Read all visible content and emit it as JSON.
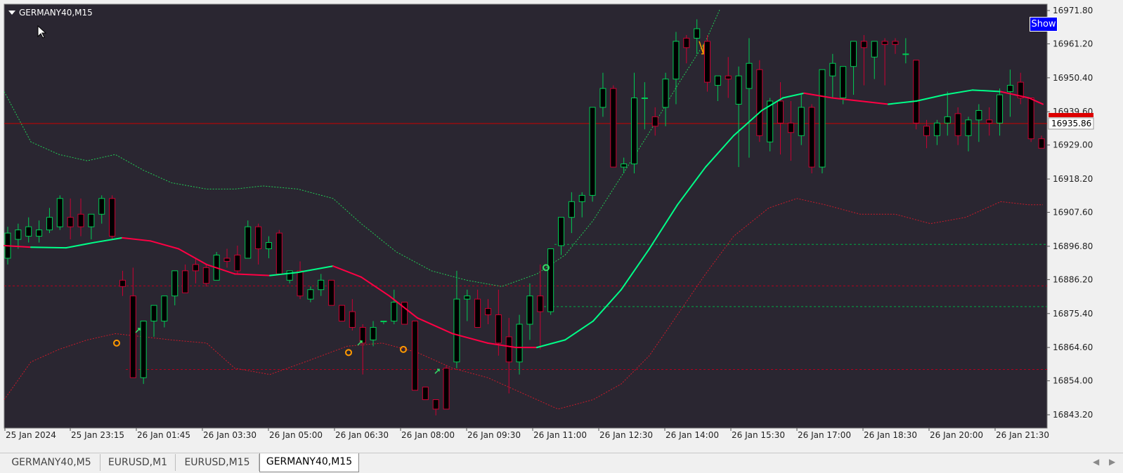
{
  "window": {
    "symbol_title": "GERMANY40,M15",
    "show_button": "Show"
  },
  "chart_data": {
    "type": "candlestick",
    "symbol": "GERMANY40",
    "timeframe": "M15",
    "current_price": 16935.86,
    "price_label": "16935.86",
    "y_ticks": [
      16971.8,
      16961.2,
      16950.4,
      16939.6,
      16929.0,
      16918.2,
      16907.6,
      16896.8,
      16886.2,
      16875.4,
      16864.6,
      16854.0,
      16843.2
    ],
    "y_tick_labels": [
      "16971.80",
      "16961.20",
      "16950.40",
      "16939.60",
      "16929.00",
      "16918.20",
      "16907.60",
      "16896.80",
      "16886.20",
      "16875.40",
      "16864.60",
      "16854.00",
      "16843.20"
    ],
    "x_tick_labels": [
      "25 Jan 2024",
      "25 Jan 23:15",
      "26 Jan 01:45",
      "26 Jan 03:30",
      "26 Jan 05:00",
      "26 Jan 06:30",
      "26 Jan 08:00",
      "26 Jan 09:30",
      "26 Jan 11:00",
      "26 Jan 12:30",
      "26 Jan 14:00",
      "26 Jan 15:30",
      "26 Jan 17:00",
      "26 Jan 18:30",
      "26 Jan 20:00",
      "26 Jan 21:30"
    ],
    "candles": [
      [
        16893,
        16903,
        16891,
        16901
      ],
      [
        16899,
        16904,
        16896,
        16902
      ],
      [
        16900,
        16906,
        16898,
        16903
      ],
      [
        16900,
        16905,
        16898,
        16902
      ],
      [
        16902,
        16909,
        16901,
        16906
      ],
      [
        16903,
        16913,
        16902,
        16912
      ],
      [
        16906,
        16912,
        16899,
        16903
      ],
      [
        16907,
        16912,
        16900,
        16903
      ],
      [
        16903,
        16907,
        16899,
        16907
      ],
      [
        16907,
        16913,
        16904,
        16912
      ],
      [
        16912,
        16913,
        16899,
        16900
      ],
      [
        16886,
        16889,
        16881,
        16884
      ],
      [
        16881,
        16890,
        16855,
        16855
      ],
      [
        16855,
        16869,
        16853,
        16873
      ],
      [
        16873,
        16877,
        16868,
        16878
      ],
      [
        16873,
        16878,
        16871,
        16881
      ],
      [
        16881,
        16889,
        16878,
        16889
      ],
      [
        16889,
        16891,
        16883,
        16882
      ],
      [
        16891,
        16893,
        16885,
        16889
      ],
      [
        16890,
        16891,
        16884,
        16885
      ],
      [
        16886,
        16895,
        16886,
        16894
      ],
      [
        16893,
        16896,
        16890,
        16892
      ],
      [
        16894,
        16897,
        16888,
        16889
      ],
      [
        16893,
        16905,
        16893,
        16903
      ],
      [
        16903,
        16904,
        16891,
        16896
      ],
      [
        16896,
        16900,
        16893,
        16898
      ],
      [
        16901,
        16902,
        16888,
        16888
      ],
      [
        16886,
        16888,
        16885,
        16889
      ],
      [
        16889,
        16892,
        16880,
        16881
      ],
      [
        16880,
        16884,
        16879,
        16883
      ],
      [
        16883,
        16888,
        16881,
        16886
      ],
      [
        16886,
        16886,
        16878,
        16878
      ],
      [
        16878,
        16877,
        16874,
        16873
      ],
      [
        16876,
        16880,
        16870,
        16871
      ],
      [
        16871,
        16872,
        16856,
        16866
      ],
      [
        16867,
        16873,
        16865,
        16871
      ],
      [
        16873,
        16873,
        16872,
        16873
      ],
      [
        16873,
        16883,
        16872,
        16879
      ],
      [
        16879,
        16878,
        16873,
        16872
      ],
      [
        16873,
        16869,
        16852,
        16851
      ],
      [
        16852,
        16852,
        16849,
        16848
      ],
      [
        16848,
        16846,
        16843,
        16845
      ],
      [
        16858,
        16859,
        16848,
        16845
      ],
      [
        16860,
        16889,
        16858,
        16880
      ],
      [
        16880,
        16883,
        16873,
        16881
      ],
      [
        16880,
        16883,
        16871,
        16871
      ],
      [
        16877,
        16880,
        16872,
        16875
      ],
      [
        16875,
        16883,
        16862,
        16866
      ],
      [
        16868,
        16874,
        16850,
        16860
      ],
      [
        16860,
        16875,
        16856,
        16872
      ],
      [
        16872,
        16885,
        16867,
        16881
      ],
      [
        16881,
        16891,
        16864,
        16876
      ],
      [
        16876,
        16896,
        16875,
        16896
      ],
      [
        16897,
        16903,
        16894,
        16906
      ],
      [
        16906,
        16914,
        16901,
        16911
      ],
      [
        16911,
        16914,
        16906,
        16913
      ],
      [
        16913,
        16941,
        16911,
        16941
      ],
      [
        16941,
        16952,
        16938,
        16947
      ],
      [
        16947,
        16948,
        16922,
        16922
      ],
      [
        16922,
        16925,
        16920,
        16923
      ],
      [
        16923,
        16952,
        16920,
        16944
      ],
      [
        16944,
        16949,
        16934,
        16944
      ],
      [
        16938,
        16941,
        16932,
        16935
      ],
      [
        16941,
        16952,
        16935,
        16950
      ],
      [
        16950,
        16965,
        16942,
        16962
      ],
      [
        16963,
        16964,
        16955,
        16960
      ],
      [
        16963,
        16969,
        16958,
        16966
      ],
      [
        16962,
        16964,
        16946,
        16949
      ],
      [
        16948,
        16951,
        16943,
        16951
      ],
      [
        16951,
        16957,
        16944,
        16950
      ],
      [
        16942,
        16954,
        16922,
        16951
      ],
      [
        16947,
        16963,
        16925,
        16955
      ],
      [
        16953,
        16956,
        16930,
        16932
      ],
      [
        16930,
        16944,
        16927,
        16943
      ],
      [
        16943,
        16949,
        16926,
        16936
      ],
      [
        16936,
        16943,
        16924,
        16933
      ],
      [
        16932,
        16945,
        16929,
        16941
      ],
      [
        16941,
        16942,
        16920,
        16922
      ],
      [
        16922,
        16952,
        16920,
        16953
      ],
      [
        16951,
        16958,
        16944,
        16955
      ],
      [
        16944,
        16953,
        16942,
        16954
      ],
      [
        16954,
        16960,
        16945,
        16962
      ],
      [
        16962,
        16964,
        16948,
        16960
      ],
      [
        16957,
        16962,
        16950,
        16962
      ],
      [
        16962,
        16963,
        16948,
        16961
      ],
      [
        16962,
        16963,
        16958,
        16961
      ],
      [
        16958,
        16963,
        16955,
        16958
      ],
      [
        16956,
        16956,
        16934,
        16936
      ],
      [
        16935,
        16937,
        16928,
        16932
      ],
      [
        16932,
        16937,
        16929,
        16936
      ],
      [
        16936,
        16946,
        16932,
        16938
      ],
      [
        16939,
        16941,
        16929,
        16932
      ],
      [
        16932,
        16938,
        16927,
        16937
      ],
      [
        16937,
        16942,
        16930,
        16940
      ],
      [
        16937,
        16941,
        16932,
        16936
      ],
      [
        16936,
        16947,
        16932,
        16945
      ],
      [
        16946,
        16953,
        16938,
        16948
      ],
      [
        16949,
        16952,
        16942,
        16944
      ],
      [
        16944,
        16943,
        16930,
        16931
      ],
      [
        16931,
        16932,
        16928,
        16928
      ]
    ]
  },
  "tabs": [
    {
      "label": "GERMANY40,M5",
      "active": false
    },
    {
      "label": "EURUSD,M1",
      "active": false
    },
    {
      "label": "EURUSD,M15",
      "active": false
    },
    {
      "label": "GERMANY40,M15",
      "active": true
    }
  ],
  "colors": {
    "background": "#2a2631",
    "bull": "#00cc55",
    "bear": "#cc0033",
    "ma_up": "#00ff88",
    "ma_down": "#ff0044",
    "current_line": "#cc0000",
    "show_button": "#0000ff"
  }
}
